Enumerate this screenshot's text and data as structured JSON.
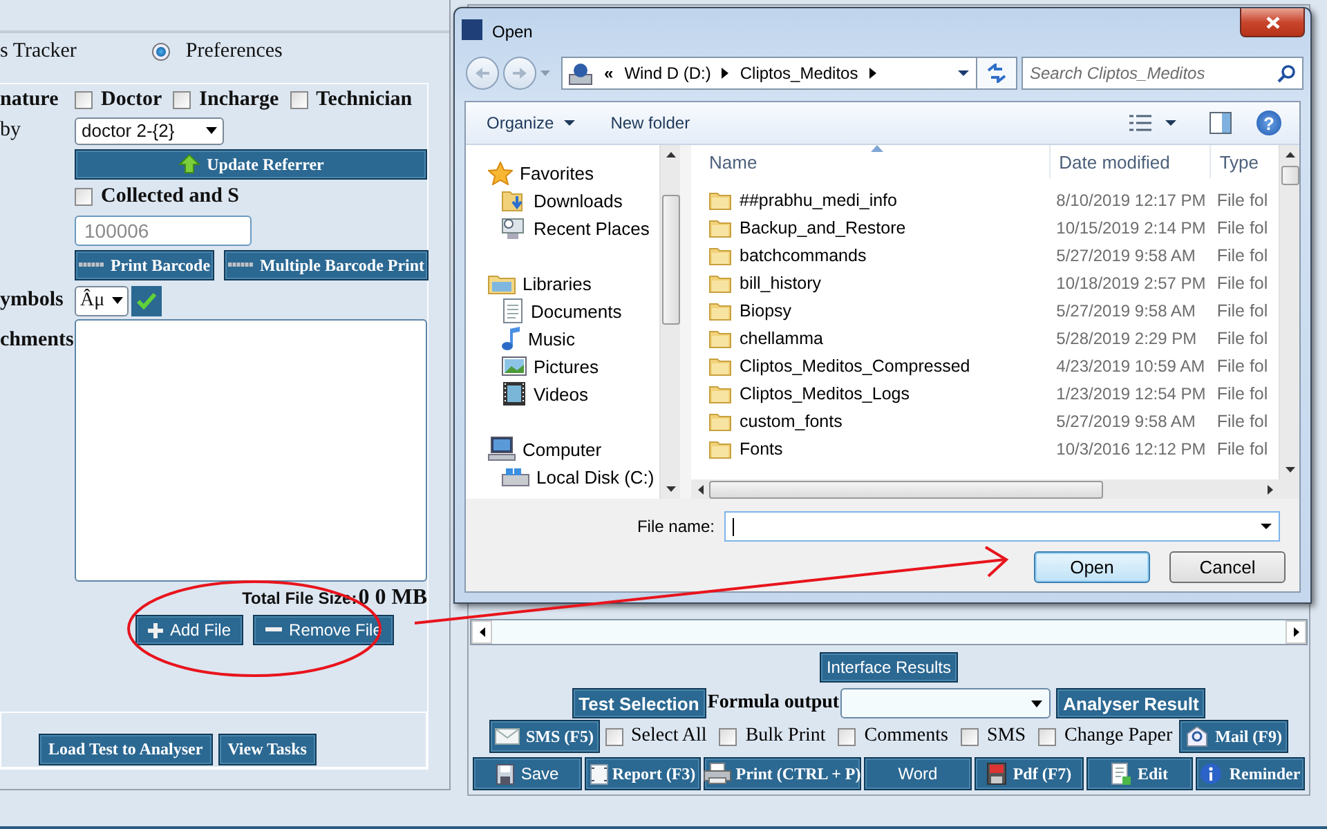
{
  "left_panel": {
    "tracker_label": "s Tracker",
    "preferences": {
      "label": "Preferences",
      "selected": true
    },
    "signature": {
      "label": "nature",
      "options": [
        {
          "label": "Doctor",
          "checked": false
        },
        {
          "label": "Incharge",
          "checked": false
        },
        {
          "label": "Technician",
          "checked": false
        }
      ]
    },
    "referrer": {
      "label": "by",
      "value": "doctor 2-{2}",
      "button": "Update Referrer"
    },
    "collected": {
      "label": "Collected and S",
      "checked": false
    },
    "barcode": {
      "placeholder": "100006",
      "buttons": [
        "Print Barcode",
        "Multiple Barcode Print"
      ]
    },
    "symbols": {
      "label": "ymbols",
      "value": "Âμ"
    },
    "attachments": {
      "label": "chments",
      "total_label": "Total File Size:",
      "total_value": "0 0 MB",
      "buttons": [
        {
          "kind": "add",
          "label": "Add File"
        },
        {
          "kind": "remove",
          "label": "Remove File"
        }
      ]
    },
    "footer_buttons": [
      "Load Test to Analyser",
      "View Tasks"
    ]
  },
  "results_panel": {
    "interface_button": "Interface Results",
    "test_selection_button": "Test Selection",
    "formula_label": "Formula output",
    "analyser_button": "Analyser Result",
    "sms_button": "SMS (F5)",
    "options": [
      {
        "label": "Select All",
        "checked": false
      },
      {
        "label": "Bulk Print",
        "checked": false
      },
      {
        "label": "Comments",
        "checked": false
      },
      {
        "label": "SMS",
        "checked": false
      },
      {
        "label": "Change Paper",
        "checked": false
      }
    ],
    "mail_button": "Mail (F9)",
    "actions": [
      {
        "kind": "save",
        "label": "Save"
      },
      {
        "kind": "report",
        "label": "Report (F3)"
      },
      {
        "kind": "print",
        "label": "Print (CTRL + P)"
      },
      {
        "kind": "word",
        "label": "Word"
      },
      {
        "kind": "pdf",
        "label": "Pdf (F7)"
      },
      {
        "kind": "edit",
        "label": "Edit"
      },
      {
        "kind": "reminder",
        "label": "Reminder"
      }
    ]
  },
  "open_dialog": {
    "title": "Open",
    "path_overflow": "«",
    "path": [
      "Wind D (D:)",
      "Cliptos_Meditos"
    ],
    "search": {
      "placeholder": "Search Cliptos_Meditos"
    },
    "toolbar": [
      {
        "kind": "menu",
        "label": "Organize"
      },
      {
        "kind": "command",
        "label": "New folder"
      }
    ],
    "help": "?",
    "navigation": [
      {
        "kind": "favorites",
        "label": "Favorites",
        "children": [
          {
            "kind": "downloads",
            "label": "Downloads"
          },
          {
            "kind": "recent",
            "label": "Recent Places"
          }
        ]
      },
      {
        "kind": "libraries",
        "label": "Libraries",
        "children": [
          {
            "kind": "documents",
            "label": "Documents"
          },
          {
            "kind": "music",
            "label": "Music"
          },
          {
            "kind": "pictures",
            "label": "Pictures"
          },
          {
            "kind": "videos",
            "label": "Videos"
          }
        ]
      },
      {
        "kind": "computer",
        "label": "Computer",
        "children": [
          {
            "kind": "disk",
            "label": "Local Disk (C:)"
          }
        ]
      }
    ],
    "columns": [
      "Name",
      "Date modified",
      "Type"
    ],
    "files": [
      {
        "name": "##prabhu_medi_info",
        "modified": "8/10/2019 12:17 PM",
        "type": "File fol"
      },
      {
        "name": "Backup_and_Restore",
        "modified": "10/15/2019 2:14 PM",
        "type": "File fol"
      },
      {
        "name": "batchcommands",
        "modified": "5/27/2019 9:58 AM",
        "type": "File fol"
      },
      {
        "name": "bill_history",
        "modified": "10/18/2019 2:57 PM",
        "type": "File fol"
      },
      {
        "name": "Biopsy",
        "modified": "5/27/2019 9:58 AM",
        "type": "File fol"
      },
      {
        "name": "chellamma",
        "modified": "5/28/2019 2:29 PM",
        "type": "File fol"
      },
      {
        "name": "Cliptos_Meditos_Compressed",
        "modified": "4/23/2019 10:59 AM",
        "type": "File fol"
      },
      {
        "name": "Cliptos_Meditos_Logs",
        "modified": "1/23/2019 12:54 PM",
        "type": "File fol"
      },
      {
        "name": "custom_fonts",
        "modified": "5/27/2019 9:58 AM",
        "type": "File fol"
      },
      {
        "name": "Fonts",
        "modified": "10/3/2016 12:12 PM",
        "type": "File fol"
      }
    ],
    "file_name_label": "File name:",
    "buttons": [
      {
        "label": "Open",
        "default": true
      },
      {
        "label": "Cancel",
        "default": false
      }
    ]
  }
}
